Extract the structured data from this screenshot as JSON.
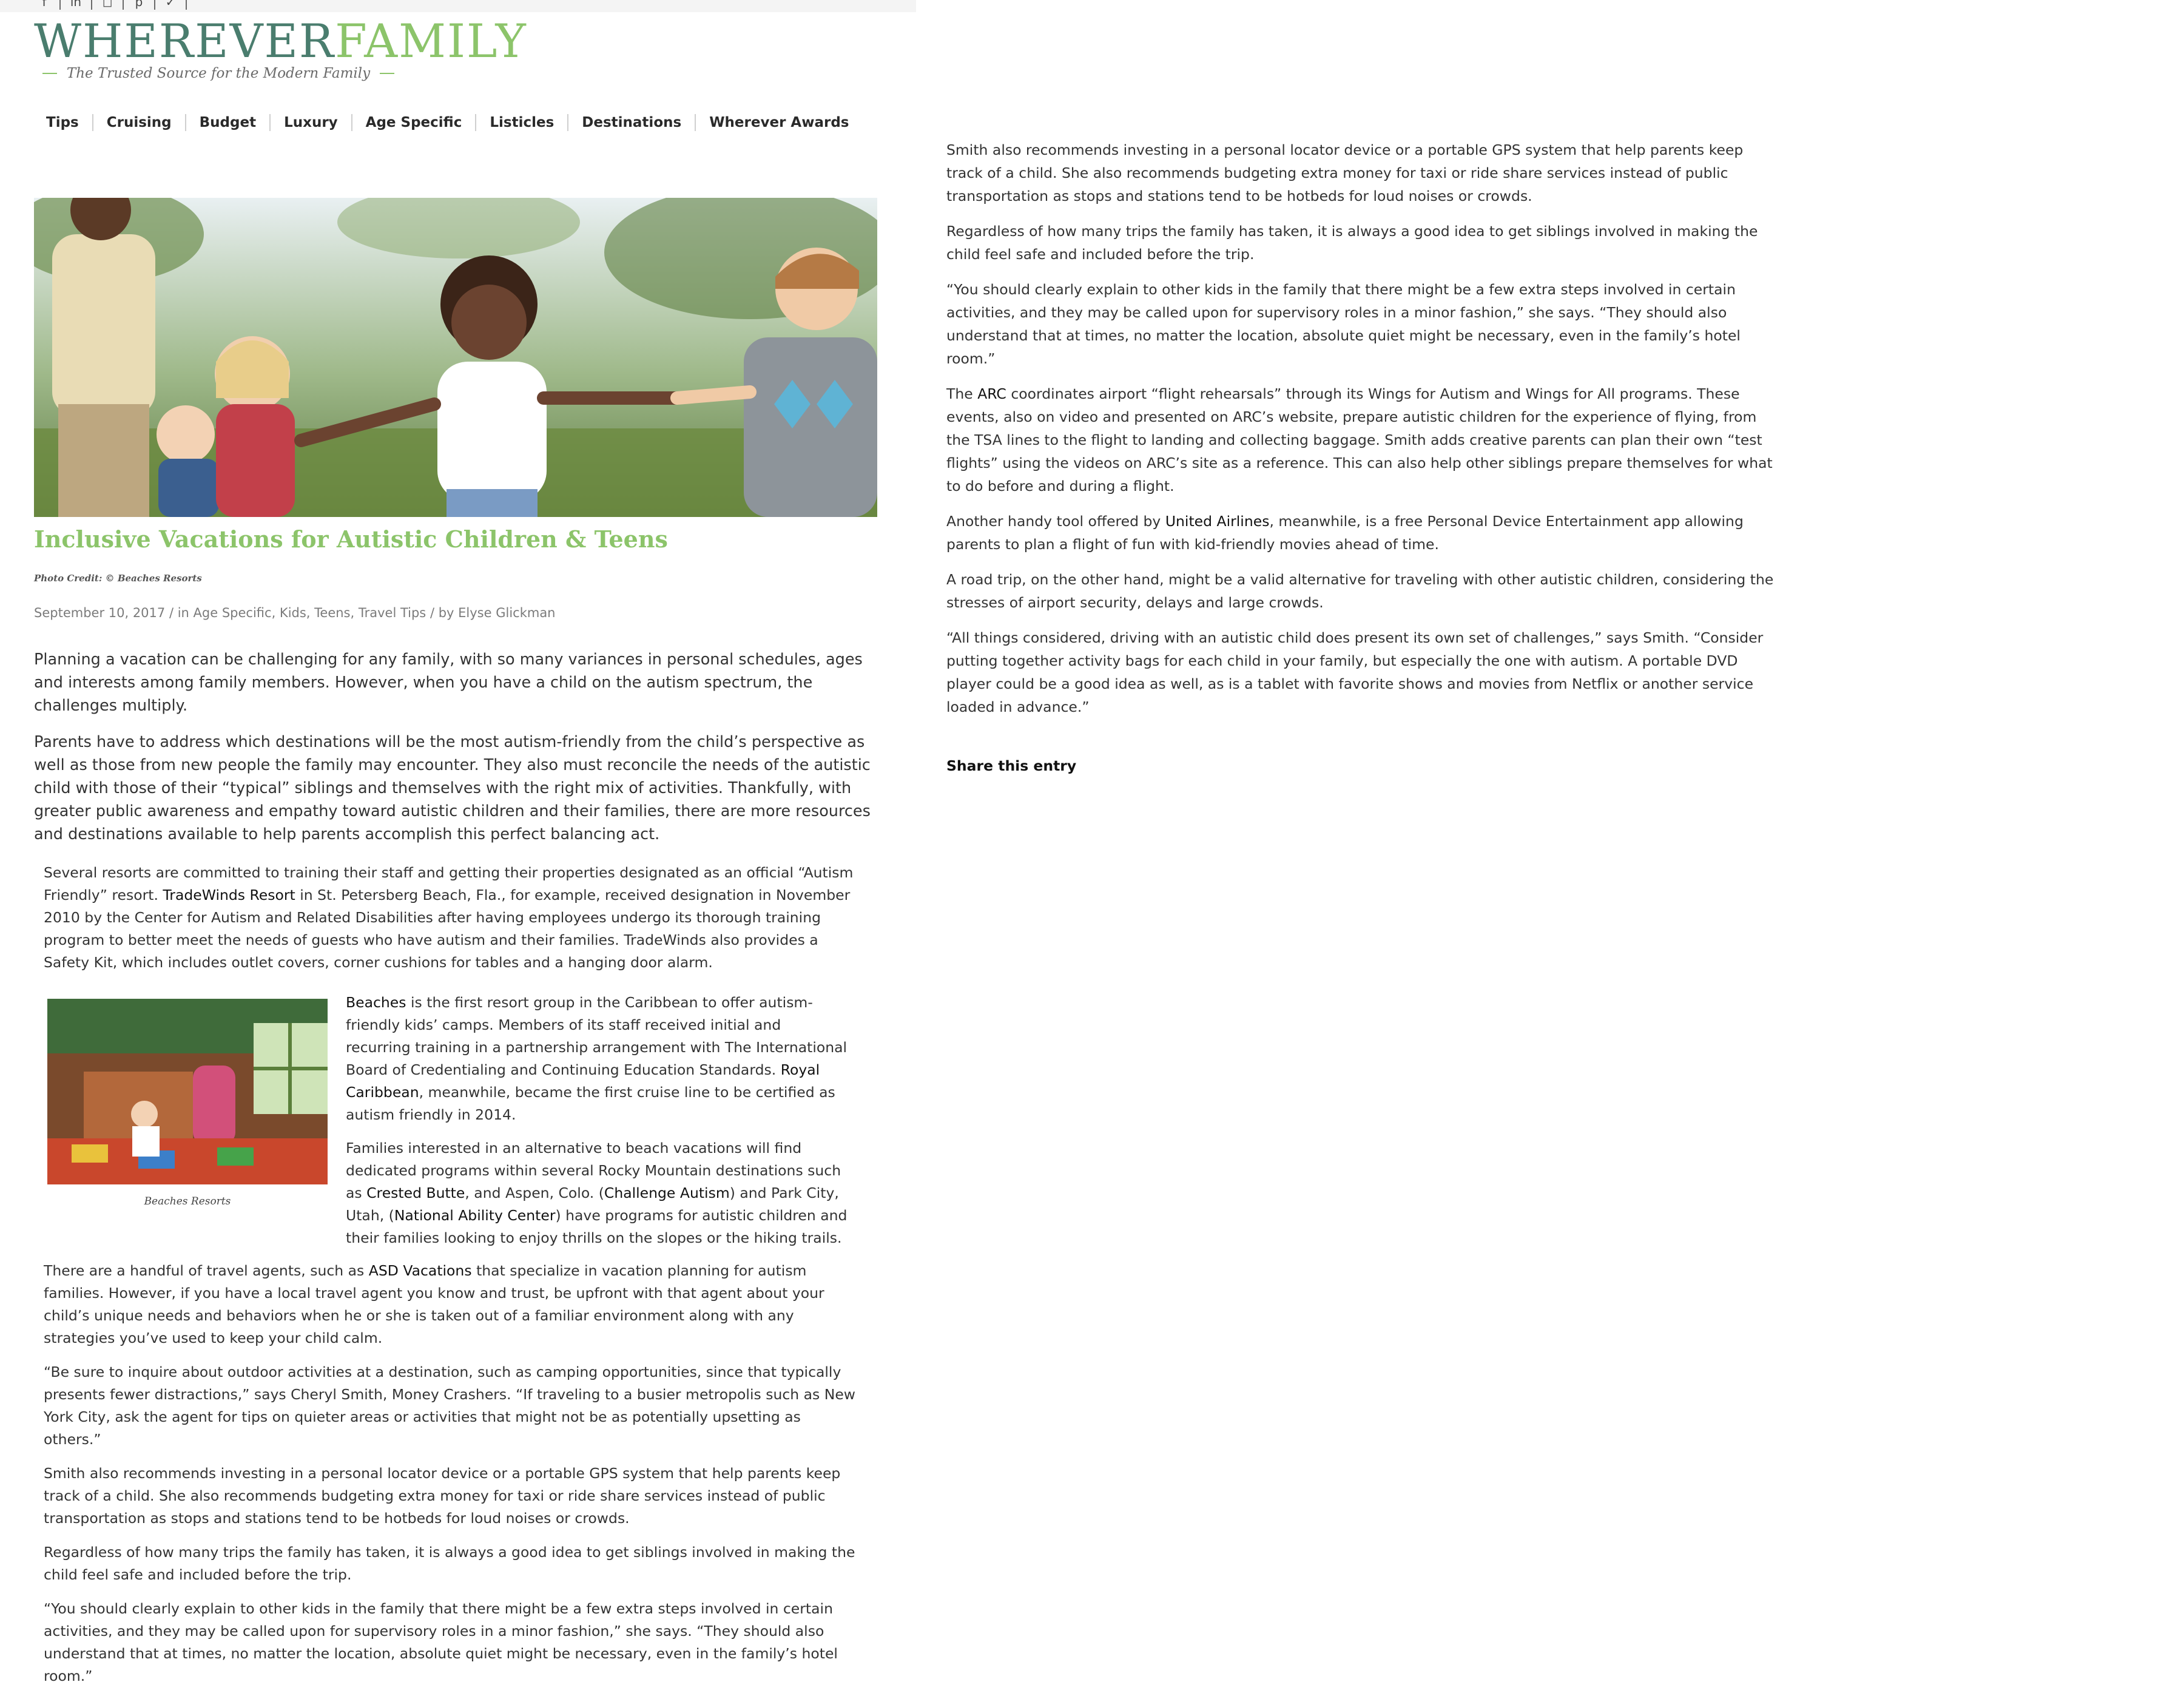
{
  "header": {
    "logo_part1": "WHEREVER",
    "logo_part2": "FAMILY",
    "tagline": "The Trusted Source for the Modern Family"
  },
  "social_icons": [
    "facebook-icon",
    "linkedin-icon",
    "instagram-icon",
    "pinterest-icon",
    "twitter-icon"
  ],
  "nav": {
    "items": [
      "Tips",
      "Cruising",
      "Budget",
      "Luxury",
      "Age Specific",
      "Listicles",
      "Destinations",
      "Wherever Awards"
    ]
  },
  "article": {
    "title": "Inclusive Vacations for Autistic Children & Teens",
    "photo_credit": "Photo Credit: © Beaches Resorts",
    "date": "September 10, 2017",
    "in_label": "/ in",
    "categories": "Age Specific, Kids, Teens, Travel Tips",
    "by_label": "/ by",
    "author": "Elyse Glickman",
    "lead_paragraphs": [
      "Planning a vacation can be challenging for any family, with so many variances in personal schedules, ages and interests among family members. However, when you have a child on the autism spectrum, the challenges multiply.",
      "Parents have to address which destinations will be the most autism-friendly from the child’s perspective as well as those from new people the family may encounter. They also must reconcile the needs of the autistic child with those of their “typical” siblings and themselves with the right mix of activities. Thankfully, with greater public awareness and empathy toward autistic children and their families, there are more resources and destinations available to help parents accomplish this perfect balancing act."
    ],
    "p_resorts_1": "Several resorts are committed to training their staff and getting their properties designated as an official “Autism Friendly” resort.",
    "link_tradewinds": "TradeWinds Resort",
    "p_resorts_2": "in St. Petersberg Beach, Fla., for example, received designation in November 2010 by the Center for Autism and Related Disabilities after having employees undergo its thorough training program to better meet the needs of guests who have autism and their families. TradeWinds also provides a Safety Kit, which includes outlet covers, corner cushions for tables and a hanging door alarm.",
    "inset_caption": "Beaches Resorts",
    "link_beaches": "Beaches",
    "p_beaches": "is the first resort group in the Caribbean to offer autism-friendly kids’ camps. Members of its staff received initial and recurring training in a partnership arrangement with The International Board of Credentialing and Continuing Education Standards.",
    "link_royal": "Royal Caribbean",
    "p_royal": ", meanwhile, became the first cruise line to be certified as autism friendly in 2014.",
    "p_families_1": "Families interested in an alternative to beach vacations will find dedicated programs within several Rocky Mountain destinations such as",
    "link_crested": "Crested Butte",
    "p_families_2": ", and Aspen, Colo. (",
    "link_challenge": "Challenge Autism",
    "p_families_3": ") and Park City, Utah, (",
    "link_nac": "National Ability Center",
    "p_families_4": ") have programs for autistic children and their families looking to enjoy thrills on the slopes or the hiking trails.",
    "p_agents_1": "There are a handful of travel agents, such as",
    "link_asd": "ASD Vacations",
    "p_agents_2": "that specialize in vacation planning for autism families. However, if you have a local travel agent you know and trust, be upfront with that agent about your child’s unique needs and behaviors when he or she is taken out of a familiar environment along with any strategies you’ve used to keep your child calm.",
    "p_outdoor": "“Be sure to inquire about outdoor activities at a destination, such as camping opportunities, since that typically presents fewer distractions,” says Cheryl Smith, Money Crashers. “If traveling to a busier metropolis such as New York City, ask the agent for tips on quieter areas or activities that might not be as potentially upsetting as others.”",
    "p_gps": "Smith also recommends investing in a personal locator device or a portable GPS system that help parents keep track of a child. She also recommends budgeting extra money for taxi or ride share services instead of public transportation as stops and stations tend to be hotbeds for loud noises or crowds.",
    "p_siblings": "Regardless of how many trips the family has taken, it is always a good idea to get siblings involved in making the child feel safe and included before the trip.",
    "p_explain": "“You should clearly explain to other kids in the family that there might be a few extra steps involved in certain activities, and they may be called upon for supervisory roles in a minor fashion,” she says. “They should also understand that at times, no matter the location, absolute quiet might be necessary, even in the family’s hotel room.”",
    "p_arc_pre": "The",
    "link_arc": "ARC",
    "p_arc": "coordinates airport “flight rehearsals” through its Wings for Autism and Wings for All programs. These events, also on video and presented on ARC’s website, prepare autistic children for the experience of flying, from the TSA lines to the flight to landing and collecting baggage. Smith adds creative parents can plan their own “test flights” using the videos on ARC’s site as a reference. This can also help other siblings prepare themselves for what to do before and during a flight.",
    "p_united_pre": "Another handy tool offered by",
    "link_united": "United Airlines",
    "p_united": ", meanwhile, is a free Personal Device Entertainment app allowing parents to plan a flight of fun with kid-friendly movies ahead of time.",
    "p_roadtrip": "A road trip, on the other hand, might be a valid alternative for traveling with other autistic children, considering the stresses of airport security, delays and large crowds.",
    "p_considered": "“All things considered, driving with an autistic child does present its own set of challenges,” says Smith. “Consider putting together activity bags for each child in your family, but especially the one with autism. A portable DVD player could be a good idea as well, as is a tablet with favorite shows and movies from Netflix or another service loaded in advance.”",
    "share_label": "Share this entry"
  },
  "colors": {
    "brand_green": "#8cc46a",
    "brand_teal": "#4a7d6e",
    "text": "#333333"
  }
}
